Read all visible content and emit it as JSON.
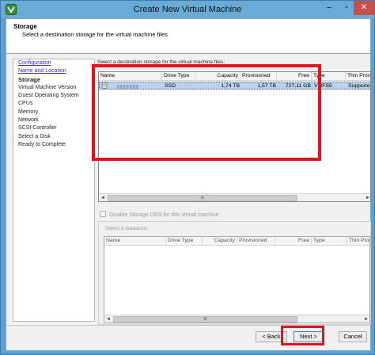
{
  "window": {
    "title": "Create New Virtual Machine",
    "min_glyph": "–",
    "max_glyph": "▫",
    "close_glyph": "✕",
    "app_icon": "vsphere-logo-icon"
  },
  "header": {
    "title": "Storage",
    "subtitle": "Select a destination storage for the virtual machine files"
  },
  "nav": {
    "items": [
      {
        "label": "Configuration",
        "state": "link"
      },
      {
        "label": "Name and Location",
        "state": "link"
      },
      {
        "label": "Storage",
        "state": "current"
      },
      {
        "label": "Virtual Machine Version",
        "state": "normal"
      },
      {
        "label": "Guest Operating System",
        "state": "normal"
      },
      {
        "label": "CPUs",
        "state": "normal"
      },
      {
        "label": "Memory",
        "state": "normal"
      },
      {
        "label": "Network",
        "state": "normal"
      },
      {
        "label": "SCSI Controller",
        "state": "normal"
      },
      {
        "label": "Select a Disk",
        "state": "normal"
      },
      {
        "label": "Ready to Complete",
        "state": "normal"
      }
    ]
  },
  "storage": {
    "label": "Select a destination storage for the virtual machine files:",
    "columns": [
      "Name",
      "Drive Type",
      "Capacity",
      "Provisioned",
      "Free",
      "Type",
      "Thin Provi"
    ],
    "rows": [
      {
        "drive_type": "SSD",
        "capacity": "1,74 TB",
        "provisioned": "1,57 TB",
        "free": "727,11 GB",
        "type": "VMFS5",
        "thin": "Supporte"
      }
    ],
    "scroll_grip": "III",
    "scroll_left": "◄",
    "scroll_right": "►"
  },
  "drs": {
    "label": "Disable Storage DRS for this virtual machine"
  },
  "datastore": {
    "label": "Select a datastore:",
    "columns": [
      "Name",
      "Drive Type",
      "Capacity",
      "Provisioned",
      "Free",
      "Type",
      "Thin Provi"
    ],
    "scroll_grip": "III",
    "scroll_left": "◄",
    "scroll_right": "►"
  },
  "footer": {
    "back": "< Back",
    "next": "Next >",
    "cancel": "Cancel"
  },
  "colors": {
    "highlight": "#e0141e",
    "selected_row": "#b9d1ea",
    "link": "#3b2fa8"
  }
}
